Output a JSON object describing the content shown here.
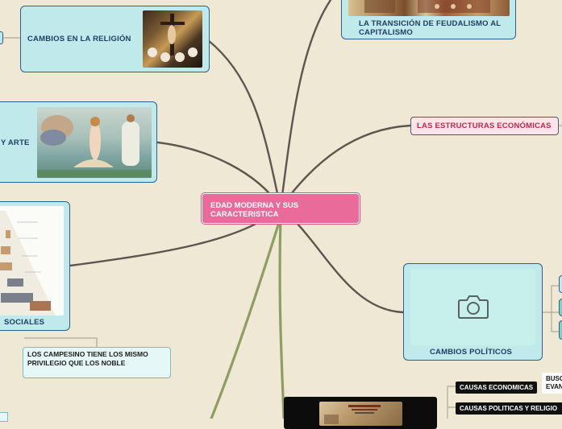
{
  "center": {
    "title": "EDAD MODERNA Y SUS CARACTERISTICA"
  },
  "topics": {
    "religion": {
      "label": "CAMBIOS EN LA RELIGIÓN"
    },
    "arte": {
      "label": "Y ARTE"
    },
    "sociales": {
      "label": "SOCIALES"
    },
    "transicion": {
      "label": "LA TRANSICIÓN DE FEUDALISMO AL CAPITALISMO"
    },
    "estructuras": {
      "label": "LAS ESTRUCTURAS ECONÓMICAS"
    },
    "politicos": {
      "label": "CAMBIOS POLÍTICOS"
    }
  },
  "notes": {
    "campesino": "LOS CAMPESINO TIENE LOS MISMO PRIVILEGIO QUE LOS NOBLE",
    "causas_economicas": "CAUSAS ECONOMICAS",
    "causas_politicas": "CAUSAS POLITICAS Y RELIGIO",
    "busc": "BUSC",
    "evan": "EVAN"
  },
  "colors": {
    "background": "#efe8d5",
    "center": "#e96b99",
    "topic_fill": "#bfe9ea",
    "topic_border": "#2e5f88",
    "economic_text": "#c2264a",
    "connector_gray": "#5b5750",
    "connector_green": "#8e9d62"
  },
  "icons": [
    "camera-icon"
  ]
}
